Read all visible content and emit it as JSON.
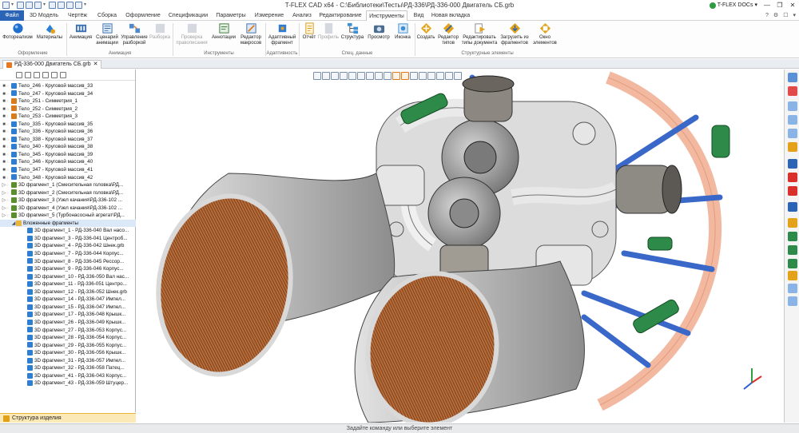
{
  "app": {
    "title": "T-FLEX CAD x64 - C:\\Библиотеки\\Тесты\\РД-336\\РД-336-000 Двигатель СБ.grb",
    "docs_label": "T-FLEX DOCs",
    "win_buttons": [
      "—",
      "❐",
      "✕"
    ],
    "help_icons": [
      "?",
      "⚙",
      "☐",
      "▾"
    ]
  },
  "tabs": [
    {
      "label": "Файл"
    },
    {
      "label": "3D Модель"
    },
    {
      "label": "Чертёж"
    },
    {
      "label": "Сборка"
    },
    {
      "label": "Оформление"
    },
    {
      "label": "Спецификации"
    },
    {
      "label": "Параметры"
    },
    {
      "label": "Измерение"
    },
    {
      "label": "Анализ"
    },
    {
      "label": "Редактирование"
    },
    {
      "label": "Инструменты"
    },
    {
      "label": "Вид"
    },
    {
      "label": "Новая вкладка"
    }
  ],
  "active_tab": "Инструменты",
  "ribbon": {
    "buttons": [
      {
        "label": "Фотореализм",
        "icon": "photorealism-icon",
        "color": "#1f6fd1"
      },
      {
        "label": "Материалы",
        "icon": "materials-icon",
        "color": "#2a7fd6"
      },
      {
        "label": "Анимация",
        "icon": "animation-icon",
        "color": "#3a6fb0"
      },
      {
        "label": "Сценарий анимации",
        "icon": "animation-script-icon",
        "color": "#3a6fb0"
      },
      {
        "label": "Управление разборкой",
        "icon": "disassembly-control-icon",
        "color": "#4b8ad1"
      },
      {
        "label": "Разборка",
        "icon": "disassembly-icon",
        "color": "#9aa6b4",
        "disabled": true
      },
      {
        "label": "Проверка правописания",
        "icon": "spellcheck-icon",
        "color": "#9aa6b4",
        "disabled": true
      },
      {
        "label": "Аннотации",
        "icon": "annotations-icon",
        "color": "#3b7a3b"
      },
      {
        "label": "Редактор макросов",
        "icon": "macro-editor-icon",
        "color": "#3a6fb0"
      },
      {
        "label": "Адаптивный фрагмент",
        "icon": "adaptive-fragment-icon",
        "color": "#2f7bd3"
      },
      {
        "label": "Отчёт",
        "icon": "report-icon",
        "color": "#d69a1c"
      },
      {
        "label": "Профиль",
        "icon": "profile-icon",
        "color": "#9aa6b4",
        "disabled": true
      },
      {
        "label": "Структура",
        "icon": "structure-icon",
        "color": "#3a8fd6"
      },
      {
        "label": "Просмотр",
        "icon": "preview-icon",
        "color": "#4d6d90"
      },
      {
        "label": "Иконка",
        "icon": "icon-tool-icon",
        "color": "#3a8fd6"
      },
      {
        "label": "Создать",
        "icon": "create-icon",
        "color": "#e3a21a"
      },
      {
        "label": "Редактор типов",
        "icon": "type-editor-icon",
        "color": "#e3a21a"
      },
      {
        "label": "Редактировать типы документа",
        "icon": "edit-doc-types-icon",
        "color": "#e3a21a"
      },
      {
        "label": "Загрузить из фрагментов",
        "icon": "load-from-fragments-icon",
        "color": "#e3a21a"
      },
      {
        "label": "Окно элементов",
        "icon": "elements-window-icon",
        "color": "#e3a21a"
      }
    ],
    "groups": [
      "Оформление",
      "Анимация",
      "Инструменты",
      "Адаптивность",
      "Спец. данные",
      "Структурные элементы"
    ]
  },
  "document_tab": {
    "label": "РД-336-000 Двигатель СБ.grb",
    "close": "✕"
  },
  "tree": {
    "rows": [
      {
        "label": "Тело_246 - Круговой массив_33",
        "kind": "body"
      },
      {
        "label": "Тело_247 - Круговой массив_34",
        "kind": "body"
      },
      {
        "label": "Тело_251 - Симметрия_1",
        "kind": "sym"
      },
      {
        "label": "Тело_252 - Симметрия_2",
        "kind": "sym"
      },
      {
        "label": "Тело_253 - Симметрия_3",
        "kind": "sym"
      },
      {
        "label": "Тело_335 - Круговой массив_35",
        "kind": "body"
      },
      {
        "label": "Тело_336 - Круговой массив_36",
        "kind": "body"
      },
      {
        "label": "Тело_338 - Круговой массив_37",
        "kind": "body"
      },
      {
        "label": "Тело_340 - Круговой массив_38",
        "kind": "body"
      },
      {
        "label": "Тело_345 - Круговой массив_39",
        "kind": "body"
      },
      {
        "label": "Тело_346 - Круговой массив_40",
        "kind": "body"
      },
      {
        "label": "Тело_347 - Круговой массив_41",
        "kind": "body"
      },
      {
        "label": "Тело_348 - Круговой массив_42",
        "kind": "body"
      },
      {
        "label": "3D фрагмент_1 (Смесительная головка\\РД...",
        "kind": "frag"
      },
      {
        "label": "3D фрагмент_2 (Смесительная головка\\РД...",
        "kind": "frag"
      },
      {
        "label": "3D фрагмент_3 (Узел качания\\РД-336-102 ...",
        "kind": "frag"
      },
      {
        "label": "3D фрагмент_4 (Узел качания\\РД-336-102 ...",
        "kind": "frag"
      },
      {
        "label": "3D фрагмент_5 (Турбонасосный агрегат\\РД...",
        "kind": "frag"
      },
      {
        "label": "Вложенные фрагменты",
        "kind": "folder"
      },
      {
        "label": "3D фрагмент_1 - РД-336-040 Вал насо...",
        "kind": "sub"
      },
      {
        "label": "3D фрагмент_3 - РД-336-041 Центроб...",
        "kind": "sub"
      },
      {
        "label": "3D фрагмент_4 - РД-336-042 Шнек.grb",
        "kind": "sub"
      },
      {
        "label": "3D фрагмент_7 - РД-336-044 Корпус...",
        "kind": "sub"
      },
      {
        "label": "3D фрагмент_8 - РД-336-045 Рессор...",
        "kind": "sub"
      },
      {
        "label": "3D фрагмент_9 - РД-336-046 Корпус...",
        "kind": "sub"
      },
      {
        "label": "3D фрагмент_10 - РД-336-050 Вал нас...",
        "kind": "sub"
      },
      {
        "label": "3D фрагмент_11 - РД-336-051 Центро...",
        "kind": "sub"
      },
      {
        "label": "3D фрагмент_12 - РД-336-052 Шнек.grb",
        "kind": "sub"
      },
      {
        "label": "3D фрагмент_14 - РД-336-047 Импел...",
        "kind": "sub"
      },
      {
        "label": "3D фрагмент_15 - РД-336-047 Импел...",
        "kind": "sub"
      },
      {
        "label": "3D фрагмент_17 - РД-336-048 Крышк...",
        "kind": "sub"
      },
      {
        "label": "3D фрагмент_26 - РД-336-049 Крышк...",
        "kind": "sub"
      },
      {
        "label": "3D фрагмент_27 - РД-336-053 Корпус...",
        "kind": "sub"
      },
      {
        "label": "3D фрагмент_28 - РД-336-054 Корпус...",
        "kind": "sub"
      },
      {
        "label": "3D фрагмент_29 - РД-336-055 Корпус...",
        "kind": "sub"
      },
      {
        "label": "3D фрагмент_30 - РД-336-056 Крышк...",
        "kind": "sub"
      },
      {
        "label": "3D фрагмент_31 - РД-336-057 Импел...",
        "kind": "sub"
      },
      {
        "label": "3D фрагмент_32 - РД-336-058 Патец...",
        "kind": "sub"
      },
      {
        "label": "3D фрагмент_41 - РД-336-043 Корпус...",
        "kind": "sub"
      },
      {
        "label": "3D фрагмент_43 - РД-336-059 Штуцер...",
        "kind": "sub"
      }
    ]
  },
  "panel_tab": "Структура изделия",
  "status": "Задайте команду или выберите элемент",
  "colors": {
    "accent": "#2b64b6",
    "nozzle": "#c9c9c9",
    "throat": "#b06a3a",
    "frame": "#3a68c9",
    "actuator": "#2d8a48",
    "ring": "#f2b9a0"
  }
}
